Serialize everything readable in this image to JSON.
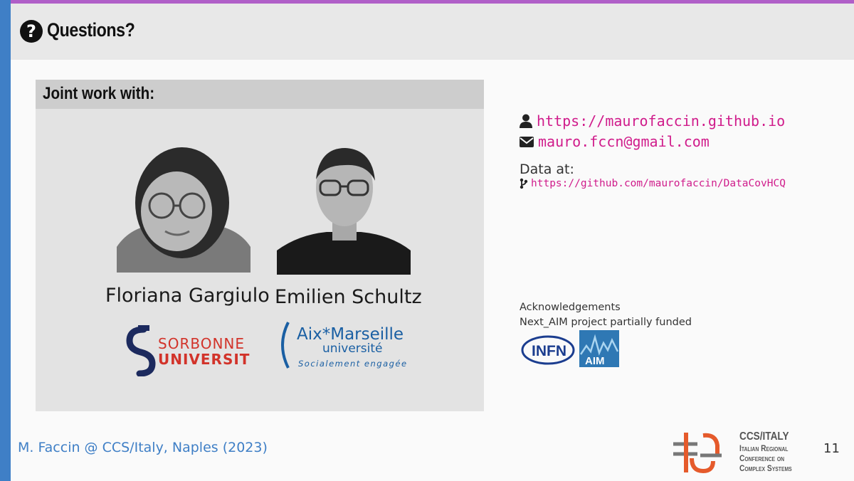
{
  "slide": {
    "title": "Questions?",
    "title_icon": "question-circle-icon",
    "accent_top": "#b05fc8",
    "accent_left": "#3f7fc6"
  },
  "collab": {
    "heading": "Joint work with:",
    "people": [
      {
        "name": "Floriana Gargiulo",
        "affiliation_logo": "sorbonne-universite-logo",
        "logo_text": [
          "SORBONNE",
          "UNIVERSITÉ"
        ]
      },
      {
        "name": "Emilien Schultz",
        "affiliation_logo": "aix-marseille-universite-logo",
        "logo_text": [
          "Aix*Marseille",
          "université",
          "Socialement engagée"
        ]
      }
    ]
  },
  "contact": {
    "website": "https://maurofaccin.github.io",
    "email": "mauro.fccn@gmail.com",
    "data_label": "Data at:",
    "data_url": "https://github.com/maurofaccin/DataCovHCQ",
    "link_color": "#d01c8b"
  },
  "acknowledgements": {
    "line1": "Acknowledgements",
    "line2": "Next_AIM project partially funded",
    "logos": [
      "INFN",
      "AIM"
    ]
  },
  "footer": {
    "author": "M. Faccin @ CCS/Italy, Naples (2023)",
    "conf_title": "CCS/ITALY",
    "conf_sub": [
      "Italian Regional",
      "Conference on",
      "Complex Systems"
    ],
    "page_number": "11"
  }
}
